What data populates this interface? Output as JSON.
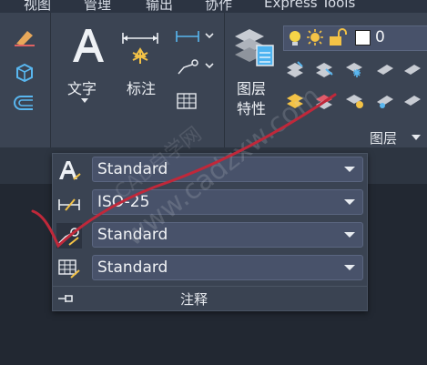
{
  "menu": {
    "items": [
      "视图",
      "管理",
      "输出",
      "协作",
      "Express Tools"
    ]
  },
  "ribbon": {
    "text_button": "文字",
    "dim_button": "标注",
    "layer_props_label": [
      "图层",
      "特性"
    ],
    "current_layer": "0",
    "layer_panel_label": "图层"
  },
  "annotation_panel": {
    "rows": [
      {
        "icon": "text-style-icon",
        "value": "Standard"
      },
      {
        "icon": "dim-style-icon",
        "value": "ISO-25"
      },
      {
        "icon": "multileader-style-icon",
        "value": "Standard"
      },
      {
        "icon": "table-style-icon",
        "value": "Standard"
      }
    ],
    "footer_label": "注释"
  },
  "watermark": "www.cadzxw.com",
  "watermark_cn": "CAD自学网",
  "colors": {
    "ribbon_bg": "#3b4453",
    "panel_bg": "#3a4352",
    "dropdown_bg": "#48526a",
    "ink": "#c0283a"
  }
}
